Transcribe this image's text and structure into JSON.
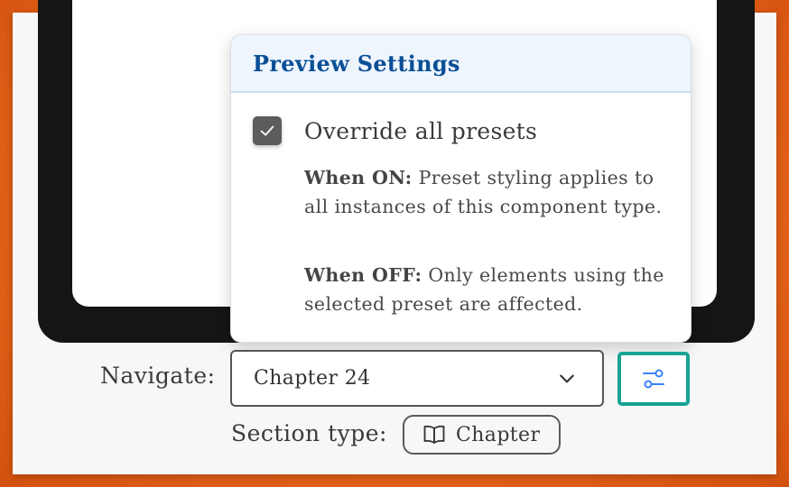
{
  "popover": {
    "title": "Preview Settings",
    "override": {
      "label": "Override all presets",
      "checked": true
    },
    "when_on": {
      "lead": "When ON:",
      "text": " Preset styling applies to all instances of this component type."
    },
    "when_off": {
      "lead": "When OFF:",
      "text": " Only elements using the selected preset are affected."
    }
  },
  "navigate": {
    "label": "Navigate:",
    "selected": "Chapter 24"
  },
  "section_type": {
    "label": "Section type:",
    "value": "Chapter",
    "icon": "book-open-icon"
  },
  "icons": {
    "settings": "sliders-icon",
    "select": "chevron-down-icon",
    "checkbox": "check-icon"
  },
  "colors": {
    "title": "#0a4f96",
    "header_bg": "#eef5fd",
    "accent_focus": "#17a394",
    "slider_icon": "#3b82f6",
    "checkbox": "#5c5c5c"
  }
}
